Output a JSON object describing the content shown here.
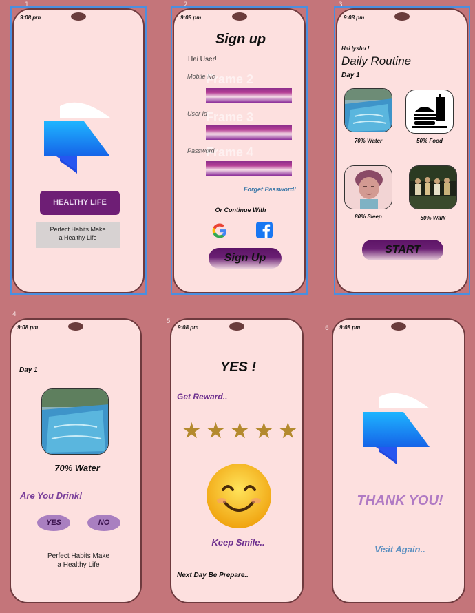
{
  "frames": {
    "f1": {
      "num": "1",
      "time": "9:08 pm",
      "badge": "HEALTHY LIFE",
      "tagline_1": "Perfect Habits Make",
      "tagline_2": "a Healthy Life"
    },
    "f2": {
      "num": "2",
      "time": "9:08 pm",
      "title": "Sign up",
      "greeting": "Hai User!",
      "mobile_label": "Mobile No",
      "userid_label": "User Id",
      "password_label": "Password",
      "ghost_1": "Frame 2",
      "ghost_2": "Frame 3",
      "ghost_3": "Frame 4",
      "forget": "Forget Password!",
      "continue": "Or Continue With",
      "signup_btn": "Sign Up"
    },
    "f3": {
      "num": "3",
      "time": "9:08 pm",
      "greeting": "Hai lyshu !",
      "title": "Daily Routine",
      "day": "Day 1",
      "water": "70% Water",
      "food": "50% Food",
      "sleep": "80% Sleep",
      "walk": "50% Walk",
      "start_btn": "START"
    },
    "f4": {
      "num": "4",
      "time": "9:08 pm",
      "day": "Day 1",
      "water": "70% Water",
      "question": "Are You Drink!",
      "yes": "YES",
      "no": "NO",
      "tagline_1": "Perfect Habits Make",
      "tagline_2": "a Healthy Life"
    },
    "f5": {
      "num": "5",
      "time": "9:08 pm",
      "title": "YES !",
      "reward": "Get Reward..",
      "smile": "Keep Smile..",
      "next": "Next  Day Be Prepare.."
    },
    "f6": {
      "num": "6",
      "time": "9:08 pm",
      "thanks": "THANK YOU!",
      "visit": "Visit Again.."
    }
  },
  "colors": {
    "background": "#c4757a",
    "phone": "#fde0df",
    "purple": "#6a1f73",
    "purple_text": "#8a3fa8",
    "link_blue": "#3b78a8",
    "gold": "#b48a2e",
    "thank_purple": "#b07ac4",
    "selection": "#4a8fe0"
  },
  "icons": [
    "google-icon",
    "facebook-icon",
    "framer-logo-icon",
    "star-icon",
    "smiley-icon",
    "burger-icon"
  ]
}
